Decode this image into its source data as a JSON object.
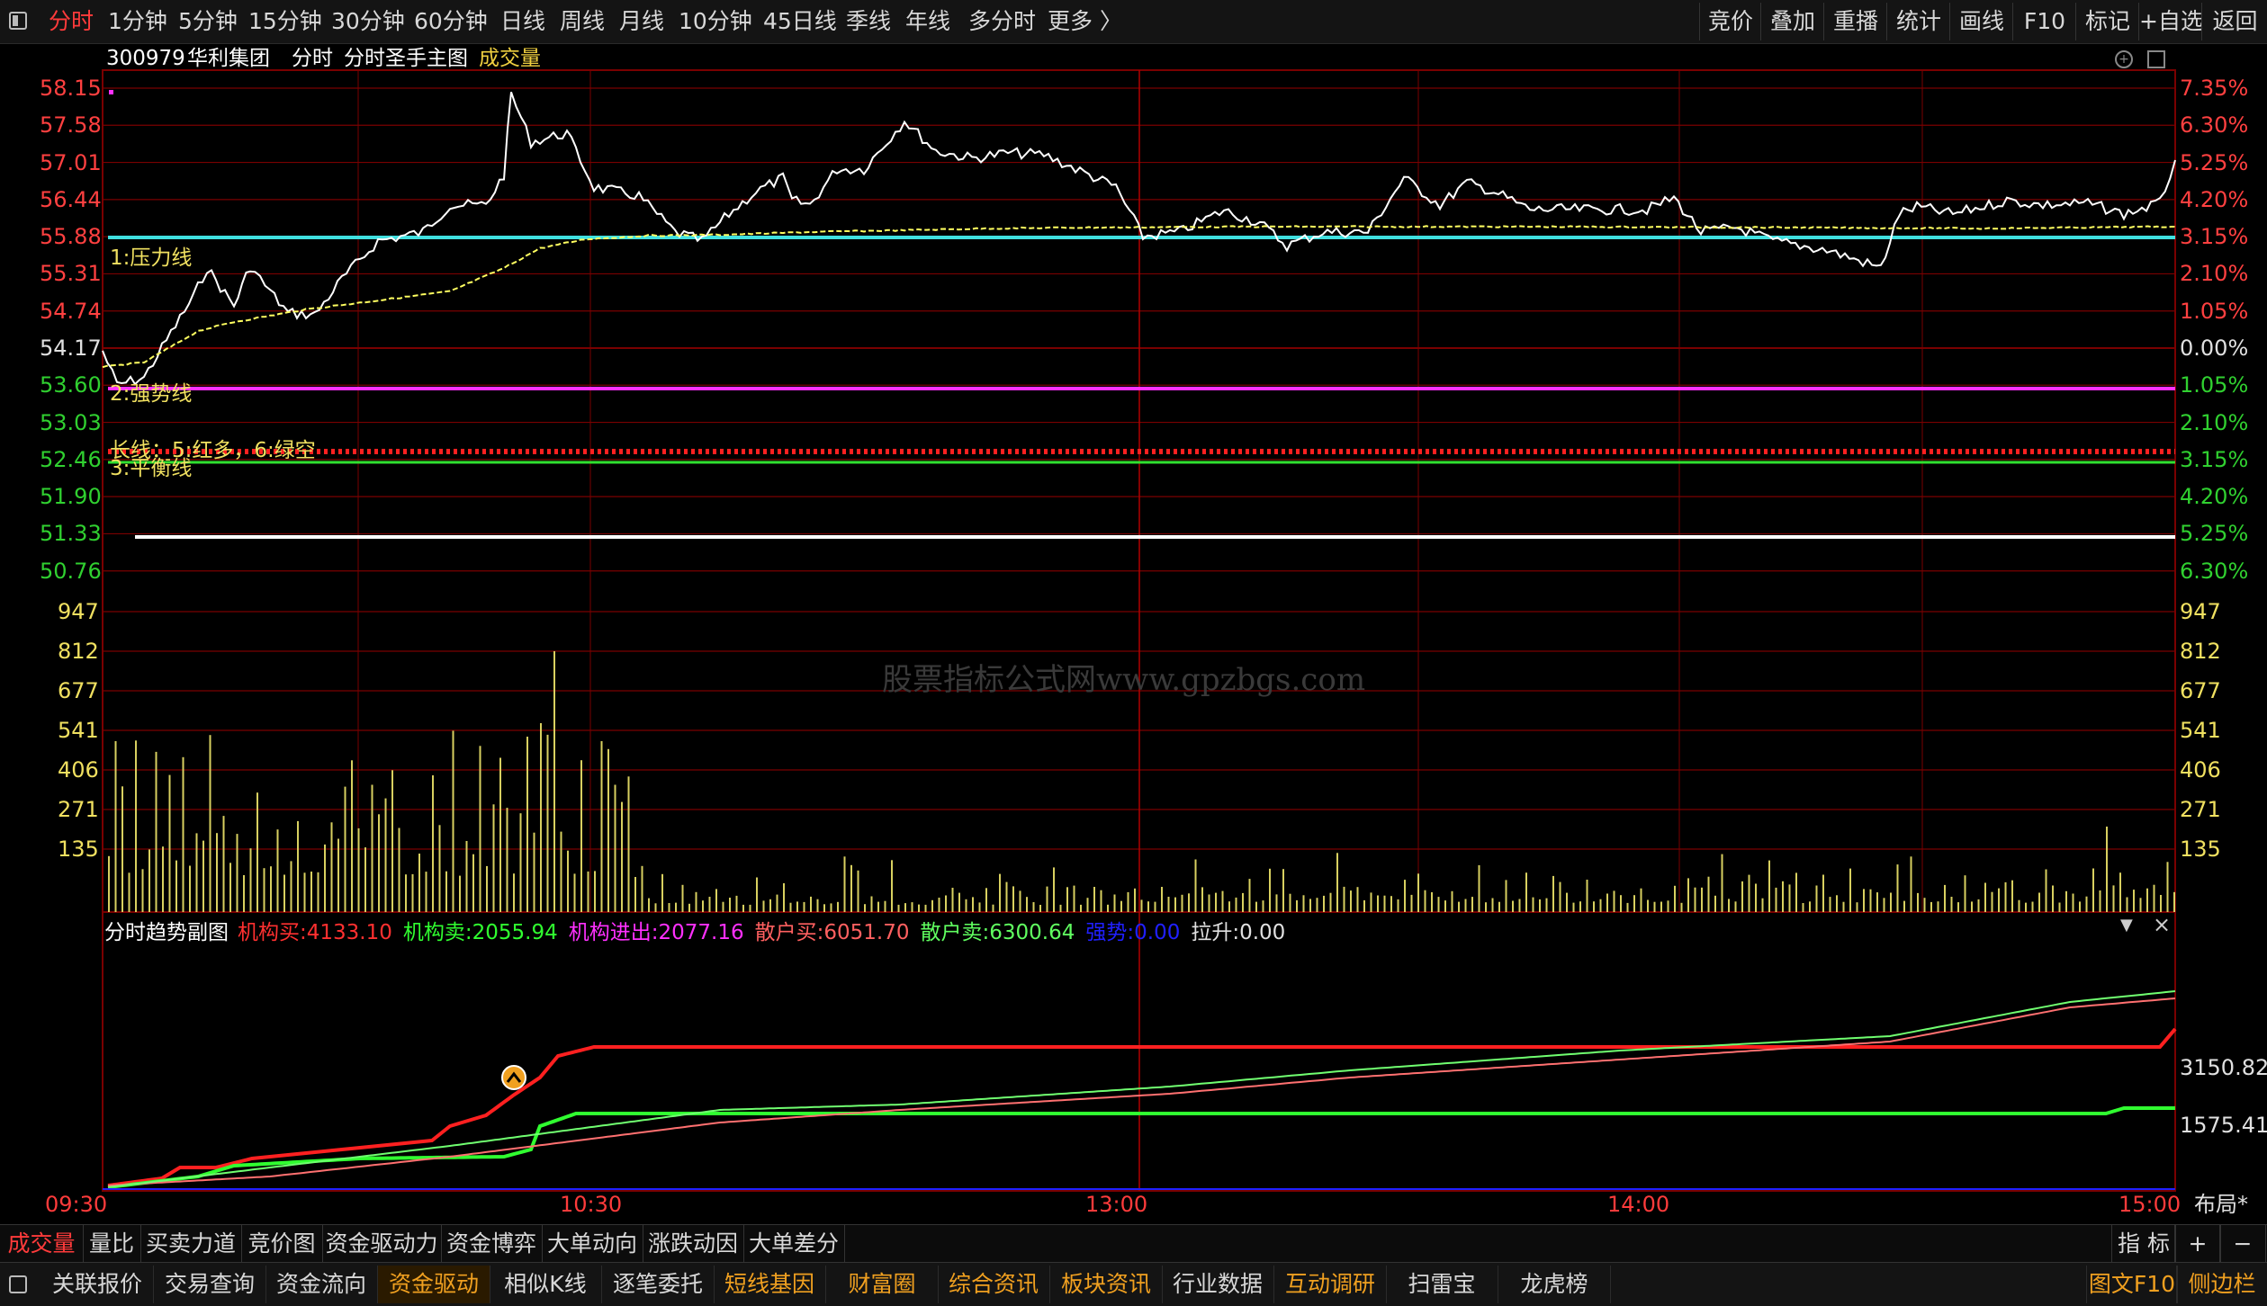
{
  "toolbar": {
    "periods": [
      "分时",
      "1分钟",
      "5分钟",
      "15分钟",
      "30分钟",
      "60分钟",
      "日线",
      "周线",
      "月线",
      "10分钟",
      "45日线",
      "季线",
      "年线",
      "多分时",
      "更多 〉"
    ],
    "right_buttons": [
      "竞价",
      "叠加",
      "重播",
      "统计",
      "画线",
      "F10",
      "标记",
      "+自选",
      "返回"
    ]
  },
  "header": {
    "code": "300979",
    "name": "华利集团",
    "view": "分时",
    "indicator": "分时圣手主图",
    "vol_label": "成交量"
  },
  "price_axis": {
    "left": [
      "58.15",
      "57.58",
      "57.01",
      "56.44",
      "55.88",
      "55.31",
      "54.74",
      "54.17",
      "53.60",
      "53.03",
      "52.46",
      "51.90",
      "51.33",
      "50.76"
    ],
    "right": [
      "7.35%",
      "6.30%",
      "5.25%",
      "4.20%",
      "3.15%",
      "2.10%",
      "1.05%",
      "0.00%",
      "1.05%",
      "2.10%",
      "3.15%",
      "4.20%",
      "5.25%",
      "6.30%"
    ],
    "prev_close": 54.17,
    "min": 50.76,
    "max": 58.15
  },
  "volume_axis": [
    "947",
    "812",
    "677",
    "541",
    "406",
    "271",
    "135"
  ],
  "time_axis": [
    "09:30",
    "10:30",
    "13:00",
    "14:00",
    "15:00"
  ],
  "annotations": {
    "pressure": "1:压力线",
    "strong": "2:强势线",
    "long_line": "长线：5:红多，6:绿空",
    "balance": "3:平衡线"
  },
  "sub_indicator": {
    "title": "分时趋势副图",
    "items": [
      {
        "label": "机构买:",
        "value": "4133.10",
        "color": "#ff3030"
      },
      {
        "label": "机构卖:",
        "value": "2055.94",
        "color": "#30ff30"
      },
      {
        "label": "机构进出:",
        "value": "2077.16",
        "color": "#ff30ff"
      },
      {
        "label": "散户买:",
        "value": "6051.70",
        "color": "#ff6060"
      },
      {
        "label": "散户卖:",
        "value": "6300.64",
        "color": "#60ff60"
      },
      {
        "label": "强势:",
        "value": "0.00",
        "color": "#2020ff"
      },
      {
        "label": "拉升:",
        "value": "0.00",
        "color": "#e0e0e0"
      }
    ],
    "axis": [
      "3150.82",
      "1575.41"
    ]
  },
  "watermark": "股票指标公式网www.gpzbgs.com",
  "layout_label": "布局*",
  "bottom_tabs": [
    "成交量",
    "量比",
    "买卖力道",
    "竞价图",
    "资金驱动力",
    "资金博弈",
    "大单动向",
    "涨跌动因",
    "大单差分"
  ],
  "bottom_right": [
    "指 标",
    "+",
    "−"
  ],
  "function_tabs": [
    "关联报价",
    "交易查询",
    "资金流向",
    "资金驱动",
    "相似K线",
    "逐笔委托",
    "短线基因",
    "财富圈",
    "综合资讯",
    "板块资讯",
    "行业数据",
    "互动调研",
    "扫雷宝",
    "龙虎榜"
  ],
  "function_right": [
    "图文F10",
    "侧边栏"
  ],
  "colors": {
    "accent": "#ff3b3b",
    "grid": "#7a0000",
    "up": "#ff4040",
    "down": "#30d030",
    "price_line": "#ffffff",
    "avg_line": "#ffff60",
    "pressure_line": "#40e0e0",
    "strong_line": "#ff30ff",
    "volume_bar": "#d8d060"
  }
}
